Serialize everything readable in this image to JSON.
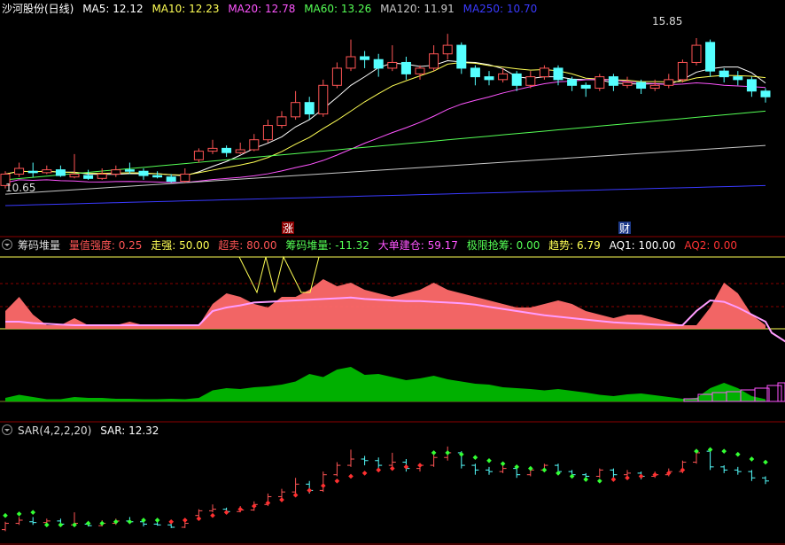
{
  "panel1": {
    "stock_name": "沙河股份(日线)",
    "ma": [
      {
        "label": "MA5: 12.12",
        "color": "#ffffff"
      },
      {
        "label": "MA10: 12.23",
        "color": "#ffff55"
      },
      {
        "label": "MA20: 12.78",
        "color": "#ff55ff"
      },
      {
        "label": "MA60: 13.26",
        "color": "#55ff55"
      },
      {
        "label": "MA120: 11.91",
        "color": "#c8c8c8"
      },
      {
        "label": "MA250: 10.70",
        "color": "#3a3aff"
      }
    ],
    "high_label": "15.85",
    "low_label": "10.65",
    "marker_zhang": "涨",
    "marker_cai": "财"
  },
  "panel2": {
    "title": "筹码堆量",
    "items": [
      {
        "label": "量值强度: 0.25",
        "color": "#ff5555"
      },
      {
        "label": "走强: 50.00",
        "color": "#ffff55"
      },
      {
        "label": "超卖: 80.00",
        "color": "#ff5555"
      },
      {
        "label": "筹码堆量: -11.32",
        "color": "#55ff55"
      },
      {
        "label": "大单建仓: 59.17",
        "color": "#ff55ff"
      },
      {
        "label": "极限抢筹: 0.00",
        "color": "#55ff55"
      },
      {
        "label": "趋势: 6.79",
        "color": "#ffff55"
      },
      {
        "label": "AQ1: 100.00",
        "color": "#ffffff"
      },
      {
        "label": "AQ2: 0.00",
        "color": "#ff3333"
      }
    ]
  },
  "panel3": {
    "title": "SAR(4,2,2,20)",
    "value_label": "SAR: 12.32"
  },
  "colors": {
    "up": "#ff5555",
    "down": "#55ffff",
    "area_red": "#ff6a6a",
    "area_green": "#00b000",
    "pink": "#ff9cff",
    "yellow": "#ffff55",
    "sar_up": "#ff3030",
    "sar_down": "#33ff33"
  },
  "chart_data": {
    "type": "candlestick",
    "x_count": 56,
    "candles": [
      [
        10.7,
        11.1,
        11.2,
        10.6
      ],
      [
        11.1,
        11.3,
        11.5,
        11.0
      ],
      [
        11.2,
        11.15,
        11.5,
        11.0
      ],
      [
        11.15,
        11.25,
        11.4,
        11.1
      ],
      [
        11.25,
        11.05,
        11.4,
        11.0
      ],
      [
        11.0,
        11.1,
        11.8,
        10.95
      ],
      [
        11.05,
        10.95,
        11.25,
        10.9
      ],
      [
        10.95,
        11.1,
        11.3,
        10.9
      ],
      [
        11.1,
        11.25,
        11.4,
        11.0
      ],
      [
        11.25,
        11.2,
        11.5,
        11.1
      ],
      [
        11.2,
        11.05,
        11.3,
        10.9
      ],
      [
        11.05,
        11.0,
        11.2,
        10.95
      ],
      [
        11.0,
        10.85,
        11.1,
        10.8
      ],
      [
        10.85,
        11.1,
        11.3,
        10.8
      ],
      [
        11.6,
        11.9,
        12.0,
        11.5
      ],
      [
        11.9,
        12.0,
        12.3,
        11.8
      ],
      [
        12.0,
        11.85,
        12.1,
        11.7
      ],
      [
        11.85,
        11.95,
        12.2,
        11.8
      ],
      [
        11.95,
        12.3,
        12.5,
        11.9
      ],
      [
        12.3,
        12.8,
        13.0,
        12.2
      ],
      [
        12.8,
        13.1,
        13.3,
        12.7
      ],
      [
        13.1,
        13.6,
        14.0,
        13.0
      ],
      [
        13.6,
        13.2,
        13.8,
        13.0
      ],
      [
        13.2,
        14.2,
        14.4,
        13.1
      ],
      [
        14.2,
        14.8,
        15.0,
        14.1
      ],
      [
        14.8,
        15.2,
        15.8,
        14.7
      ],
      [
        15.2,
        15.1,
        15.4,
        14.8
      ],
      [
        15.1,
        14.8,
        15.3,
        14.5
      ],
      [
        14.8,
        15.0,
        15.6,
        14.7
      ],
      [
        15.0,
        14.6,
        15.2,
        14.4
      ],
      [
        14.6,
        14.8,
        14.9,
        14.4
      ],
      [
        14.8,
        15.3,
        15.6,
        14.7
      ],
      [
        15.3,
        15.6,
        16.0,
        15.1
      ],
      [
        15.6,
        14.8,
        15.7,
        14.6
      ],
      [
        14.8,
        14.5,
        14.9,
        14.2
      ],
      [
        14.5,
        14.4,
        14.7,
        14.2
      ],
      [
        14.4,
        14.6,
        14.8,
        14.3
      ],
      [
        14.6,
        14.2,
        14.7,
        14.0
      ],
      [
        14.2,
        14.5,
        14.7,
        14.1
      ],
      [
        14.5,
        14.8,
        14.9,
        14.4
      ],
      [
        14.8,
        14.4,
        14.9,
        14.2
      ],
      [
        14.4,
        14.2,
        14.5,
        14.0
      ],
      [
        14.2,
        14.1,
        14.3,
        13.8
      ],
      [
        14.1,
        14.5,
        14.6,
        14.0
      ],
      [
        14.5,
        14.2,
        14.6,
        14.0
      ],
      [
        14.2,
        14.3,
        14.5,
        14.1
      ],
      [
        14.3,
        14.1,
        14.4,
        13.9
      ],
      [
        14.1,
        14.2,
        14.4,
        14.0
      ],
      [
        14.2,
        14.4,
        14.6,
        14.1
      ],
      [
        14.4,
        15.0,
        15.1,
        14.3
      ],
      [
        15.0,
        15.6,
        15.85,
        14.9
      ],
      [
        15.7,
        14.7,
        15.8,
        14.5
      ],
      [
        14.7,
        14.5,
        14.8,
        14.3
      ],
      [
        14.5,
        14.4,
        14.7,
        14.2
      ],
      [
        14.4,
        14.0,
        14.5,
        13.8
      ],
      [
        14.0,
        13.8,
        14.1,
        13.6
      ]
    ],
    "y_range": [
      10.0,
      16.5
    ],
    "panel2_area_red": [
      0.25,
      0.45,
      0.2,
      0.05,
      0.05,
      0.15,
      0.05,
      0.05,
      0.05,
      0.1,
      0.05,
      0.05,
      0.05,
      0.05,
      0.05,
      0.35,
      0.5,
      0.45,
      0.35,
      0.3,
      0.45,
      0.45,
      0.55,
      0.7,
      0.6,
      0.65,
      0.55,
      0.5,
      0.45,
      0.5,
      0.55,
      0.65,
      0.55,
      0.5,
      0.45,
      0.4,
      0.35,
      0.3,
      0.3,
      0.35,
      0.4,
      0.35,
      0.25,
      0.2,
      0.15,
      0.2,
      0.2,
      0.15,
      0.1,
      0.05,
      0.05,
      0.3,
      0.65,
      0.5,
      0.2,
      0.05
    ],
    "panel2_pink": [
      0.1,
      0.1,
      0.08,
      0.07,
      0.06,
      0.05,
      0.05,
      0.05,
      0.05,
      0.05,
      0.05,
      0.05,
      0.05,
      0.05,
      0.05,
      0.25,
      0.3,
      0.33,
      0.37,
      0.38,
      0.39,
      0.4,
      0.41,
      0.42,
      0.43,
      0.44,
      0.42,
      0.41,
      0.4,
      0.39,
      0.39,
      0.38,
      0.37,
      0.36,
      0.34,
      0.31,
      0.28,
      0.25,
      0.22,
      0.19,
      0.17,
      0.15,
      0.13,
      0.11,
      0.09,
      0.08,
      0.07,
      0.06,
      0.05,
      0.05,
      0.25,
      0.4,
      0.38,
      0.3,
      0.2,
      0.1
    ],
    "panel2_green": [
      0.08,
      0.15,
      0.1,
      0.05,
      0.05,
      0.1,
      0.08,
      0.08,
      0.06,
      0.06,
      0.05,
      0.05,
      0.06,
      0.05,
      0.08,
      0.25,
      0.3,
      0.28,
      0.32,
      0.34,
      0.38,
      0.45,
      0.62,
      0.55,
      0.72,
      0.78,
      0.6,
      0.62,
      0.55,
      0.48,
      0.52,
      0.58,
      0.5,
      0.45,
      0.4,
      0.38,
      0.32,
      0.3,
      0.28,
      0.25,
      0.28,
      0.24,
      0.2,
      0.15,
      0.12,
      0.16,
      0.18,
      0.14,
      0.1,
      0.06,
      0.08,
      0.3,
      0.42,
      0.3,
      0.12,
      0.05
    ],
    "panel3_sar": [
      11.6,
      11.7,
      11.8,
      11.0,
      11.0,
      11.0,
      11.1,
      11.1,
      11.2,
      11.2,
      11.3,
      11.3,
      11.2,
      11.3,
      11.4,
      11.6,
      11.8,
      12.0,
      12.2,
      12.4,
      12.6,
      12.9,
      13.2,
      13.5,
      13.8,
      14.1,
      14.3,
      14.5,
      14.6,
      14.7,
      14.8,
      15.6,
      15.6,
      15.5,
      15.3,
      15.1,
      14.9,
      14.7,
      14.6,
      14.5,
      14.3,
      14.1,
      13.9,
      13.8,
      13.9,
      14.0,
      14.1,
      14.2,
      14.3,
      14.5,
      15.7,
      15.8,
      15.7,
      15.5,
      15.2,
      15.0
    ],
    "panel3_sar_up": [
      false,
      false,
      false,
      false,
      false,
      false,
      false,
      false,
      false,
      false,
      false,
      false,
      true,
      true,
      true,
      true,
      true,
      true,
      true,
      true,
      true,
      true,
      true,
      true,
      true,
      true,
      true,
      true,
      true,
      true,
      true,
      false,
      false,
      false,
      false,
      false,
      false,
      false,
      false,
      false,
      false,
      false,
      false,
      false,
      true,
      true,
      true,
      true,
      true,
      true,
      false,
      false,
      false,
      false,
      false,
      false
    ]
  }
}
